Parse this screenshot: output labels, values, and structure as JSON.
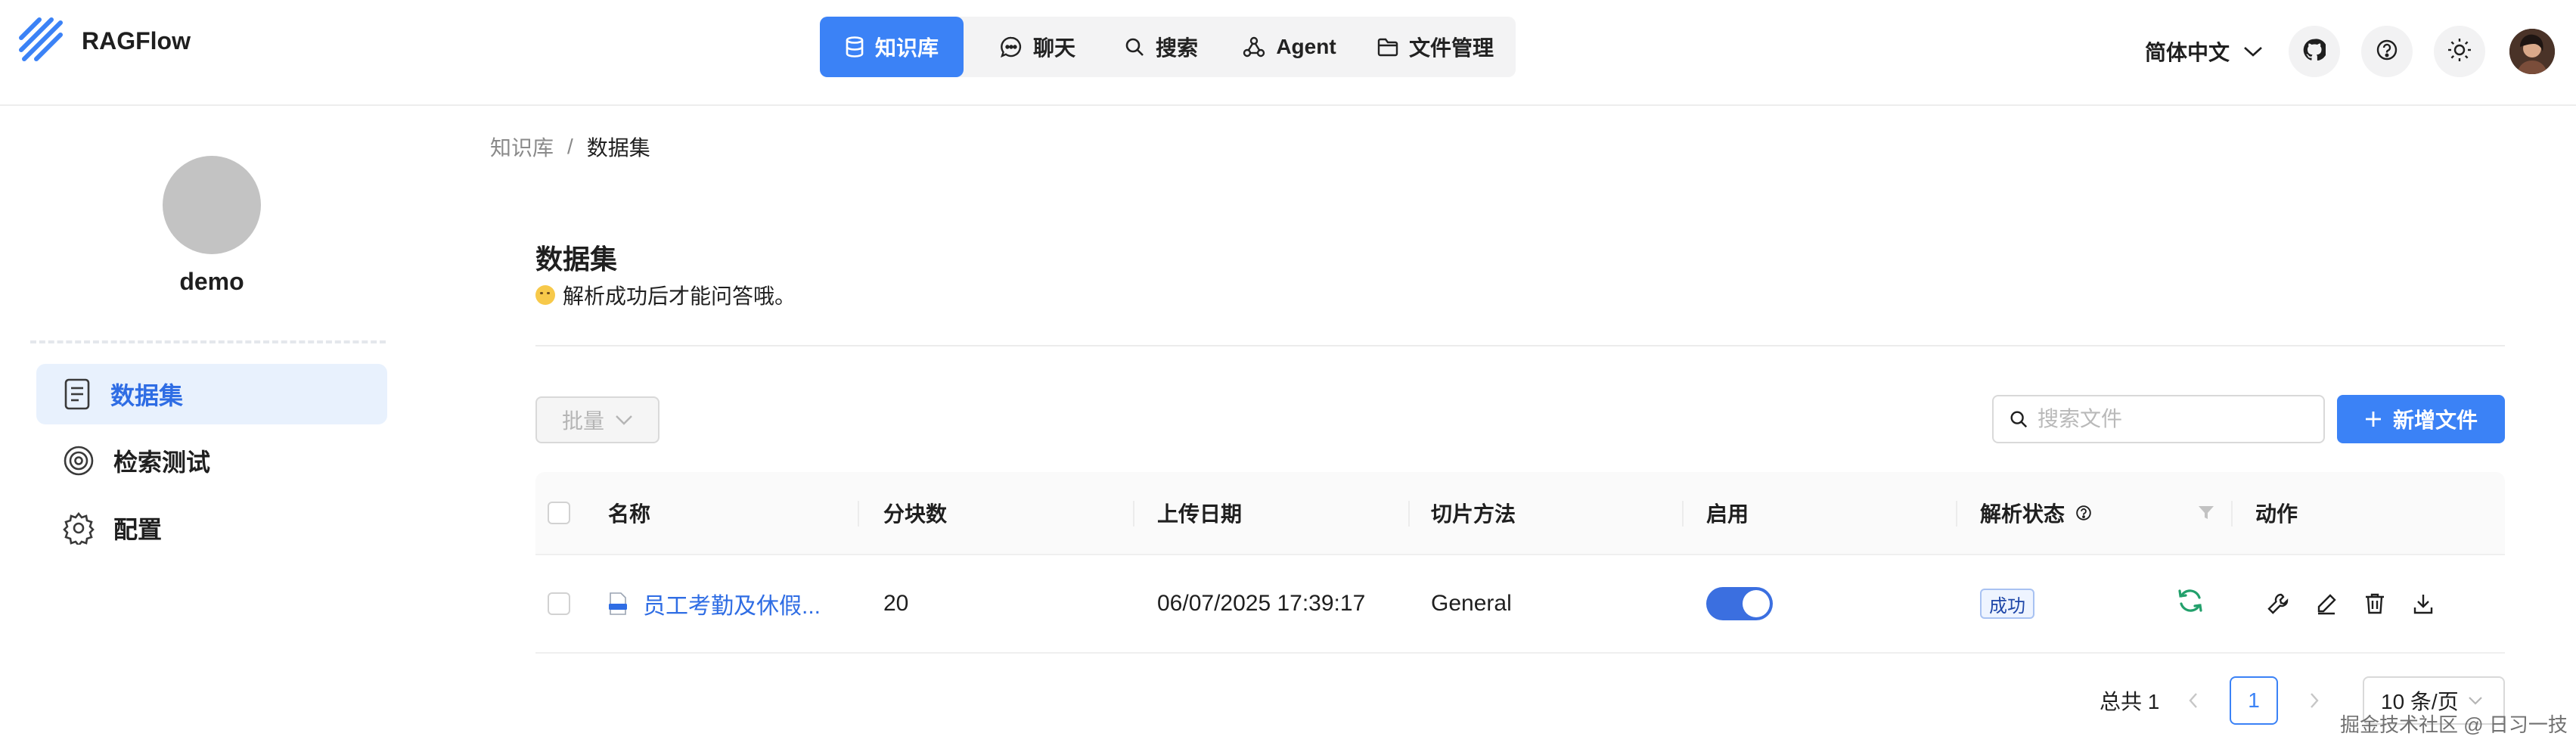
{
  "brand": {
    "name": "RAGFlow"
  },
  "nav": {
    "items": [
      {
        "label": "知识库",
        "icon": "database-icon",
        "active": true
      },
      {
        "label": "聊天",
        "icon": "chat-bubble-icon",
        "active": false
      },
      {
        "label": "搜索",
        "icon": "search-icon",
        "active": false
      },
      {
        "label": "Agent",
        "icon": "agent-graph-icon",
        "active": false
      },
      {
        "label": "文件管理",
        "icon": "folder-icon",
        "active": false
      }
    ]
  },
  "header": {
    "language": "简体中文",
    "icons": [
      "github-icon",
      "help-icon",
      "theme-sun-icon"
    ]
  },
  "sidebar": {
    "profile_name": "demo",
    "items": [
      {
        "label": "数据集",
        "icon": "document-icon",
        "active": true
      },
      {
        "label": "检索测试",
        "icon": "target-icon",
        "active": false
      },
      {
        "label": "配置",
        "icon": "gear-icon",
        "active": false
      }
    ]
  },
  "breadcrumb": {
    "parent": "知识库",
    "separator": "/",
    "current": "数据集"
  },
  "page": {
    "title": "数据集",
    "subtitle": "解析成功后才能问答哦。"
  },
  "toolbar": {
    "bulk_label": "批量",
    "search_placeholder": "搜索文件",
    "add_label": "新增文件"
  },
  "table": {
    "headers": {
      "name": "名称",
      "chunks": "分块数",
      "upload_date": "上传日期",
      "chunk_method": "切片方法",
      "enabled": "启用",
      "parse_status": "解析状态",
      "actions": "动作"
    },
    "rows": [
      {
        "name": "员工考勤及休假...",
        "chunks": "20",
        "upload_date": "06/07/2025 17:39:17",
        "chunk_method": "General",
        "enabled": true,
        "status": "成功"
      }
    ]
  },
  "pagination": {
    "total": "总共 1",
    "current_page": "1",
    "page_size": "10 条/页"
  },
  "watermark": "掘金技术社区 @ 日习一技",
  "colors": {
    "accent": "#3b82f6",
    "active_bg": "#e8f1fd",
    "success": "#22a06b"
  }
}
